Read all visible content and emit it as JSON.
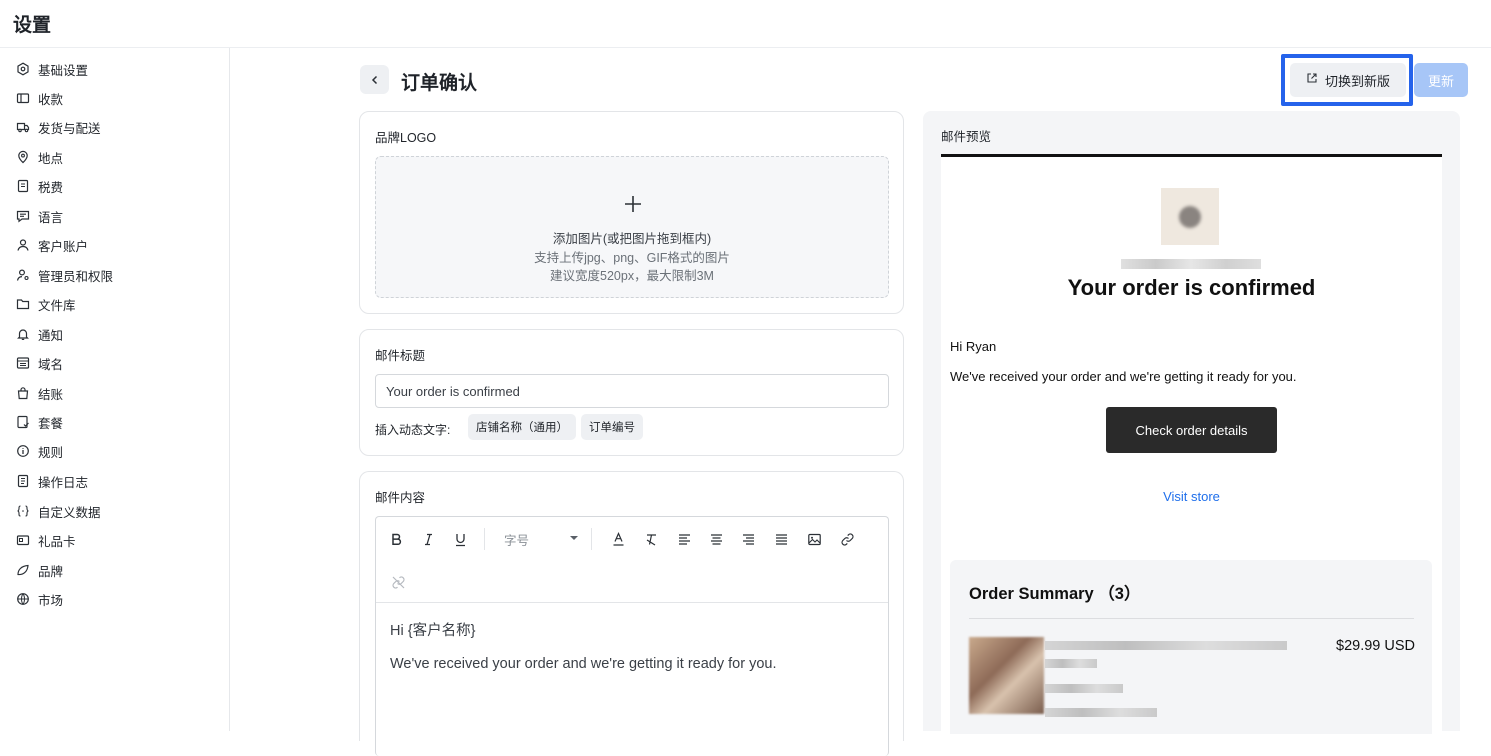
{
  "app": {
    "title": "设置"
  },
  "sidebar": {
    "items": [
      {
        "label": "基础设置",
        "icon": "hexagon-settings-icon"
      },
      {
        "label": "收款",
        "icon": "wallet-icon"
      },
      {
        "label": "发货与配送",
        "icon": "truck-icon"
      },
      {
        "label": "地点",
        "icon": "location-pin-icon"
      },
      {
        "label": "税费",
        "icon": "receipt-icon"
      },
      {
        "label": "语言",
        "icon": "chat-icon"
      },
      {
        "label": "客户账户",
        "icon": "user-icon"
      },
      {
        "label": "管理员和权限",
        "icon": "user-key-icon"
      },
      {
        "label": "文件库",
        "icon": "folder-icon"
      },
      {
        "label": "通知",
        "icon": "bell-icon"
      },
      {
        "label": "域名",
        "icon": "domain-icon"
      },
      {
        "label": "结账",
        "icon": "bag-icon"
      },
      {
        "label": "套餐",
        "icon": "plan-icon"
      },
      {
        "label": "规则",
        "icon": "info-icon"
      },
      {
        "label": "操作日志",
        "icon": "log-icon"
      },
      {
        "label": "自定义数据",
        "icon": "code-braces-icon"
      },
      {
        "label": "礼品卡",
        "icon": "gift-card-icon"
      },
      {
        "label": "品牌",
        "icon": "brand-icon"
      },
      {
        "label": "市场",
        "icon": "globe-icon"
      }
    ]
  },
  "header": {
    "page_title": "订单确认",
    "switch_label": "切换到新版",
    "update_label": "更新"
  },
  "logo_card": {
    "label": "品牌LOGO",
    "upload_line1": "添加图片(或把图片拖到框内)",
    "upload_line2": "支持上传jpg、png、GIF格式的图片",
    "upload_line3": "建议宽度520px，最大限制3M"
  },
  "subject_card": {
    "label": "邮件标题",
    "value": "Your order is confirmed",
    "insert_label": "插入动态文字:",
    "chips": [
      "店铺名称（通用）",
      "订单编号"
    ]
  },
  "content_card": {
    "label": "邮件内容",
    "font_size_placeholder": "字号",
    "toolbar": [
      "bold-icon",
      "italic-icon",
      "underline-icon",
      "font-color-icon",
      "clear-format-icon",
      "align-left-icon",
      "align-center-icon",
      "align-right-icon",
      "align-justify-icon",
      "image-icon",
      "link-icon",
      "unlink-icon"
    ],
    "body_line1": "Hi {客户名称}",
    "body_line2": "We've received your order and we're getting it ready for you."
  },
  "preview": {
    "label": "邮件预览",
    "headline": "Your order is confirmed",
    "greeting": "Hi Ryan",
    "message": "We've received your order and we're getting it ready for you.",
    "button_label": "Check order details",
    "link_label": "Visit store",
    "summary_title": "Order Summary （3）",
    "price": "$29.99 USD"
  },
  "colors": {
    "accent": "#2563eb",
    "update_button": "#a7c6f7",
    "preview_button": "#2a2a2a",
    "link": "#1f6feb"
  }
}
